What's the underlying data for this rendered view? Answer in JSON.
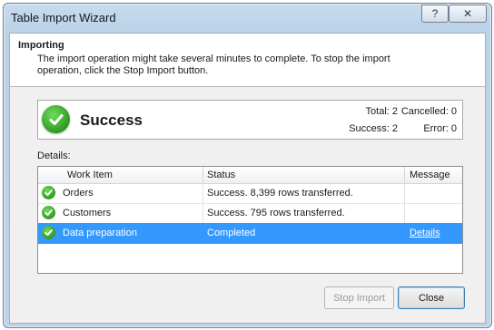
{
  "window": {
    "title": "Table Import Wizard",
    "help_glyph": "?",
    "close_glyph": "✕"
  },
  "header": {
    "title": "Importing",
    "description": "The import operation might take several minutes to complete. To stop the import operation, click the Stop Import button."
  },
  "summary": {
    "status": "Success",
    "total": "Total: 2",
    "cancelled": "Cancelled: 0",
    "success": "Success: 2",
    "error": "Error: 0",
    "status_color": "#2f9a22"
  },
  "details": {
    "label": "Details:",
    "columns": [
      "Work Item",
      "Status",
      "Message"
    ],
    "rows": [
      {
        "work_item": "Orders",
        "status": "Success. 8,399 rows transferred.",
        "message": ""
      },
      {
        "work_item": "Customers",
        "status": "Success. 795 rows transferred.",
        "message": ""
      },
      {
        "work_item": "Data preparation",
        "status": "Completed",
        "message": "Details"
      }
    ],
    "selected_row_color": "#3399ff"
  },
  "buttons": {
    "stop_import": "Stop Import",
    "close": "Close"
  }
}
